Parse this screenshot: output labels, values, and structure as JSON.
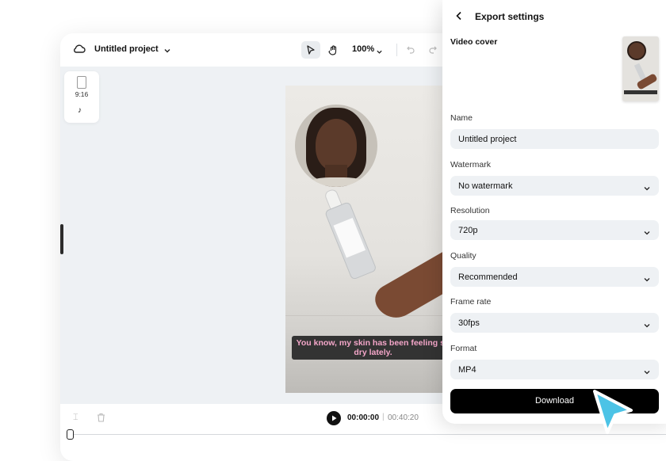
{
  "header": {
    "project_title": "Untitled project",
    "zoom": "100%"
  },
  "format": {
    "ratio": "9:16"
  },
  "video": {
    "caption": "You know, my skin has been feeling so dry lately."
  },
  "playback": {
    "current_time": "00:00:00",
    "separator": "|",
    "total_time": "00:40:20"
  },
  "export_panel": {
    "title": "Export settings",
    "video_cover_label": "Video cover",
    "fields": [
      {
        "label": "Name",
        "value": "Untitled project",
        "dropdown": false
      },
      {
        "label": "Watermark",
        "value": "No watermark",
        "dropdown": true
      },
      {
        "label": "Resolution",
        "value": "720p",
        "dropdown": true
      },
      {
        "label": "Quality",
        "value": "Recommended",
        "dropdown": true
      },
      {
        "label": "Frame rate",
        "value": "30fps",
        "dropdown": true
      },
      {
        "label": "Format",
        "value": "MP4",
        "dropdown": true
      }
    ],
    "download_label": "Download"
  },
  "colors": {
    "accent_cursor": "#4cc3e6",
    "caption_text": "#f4a6c9",
    "canvas_bg": "#eef1f4"
  }
}
